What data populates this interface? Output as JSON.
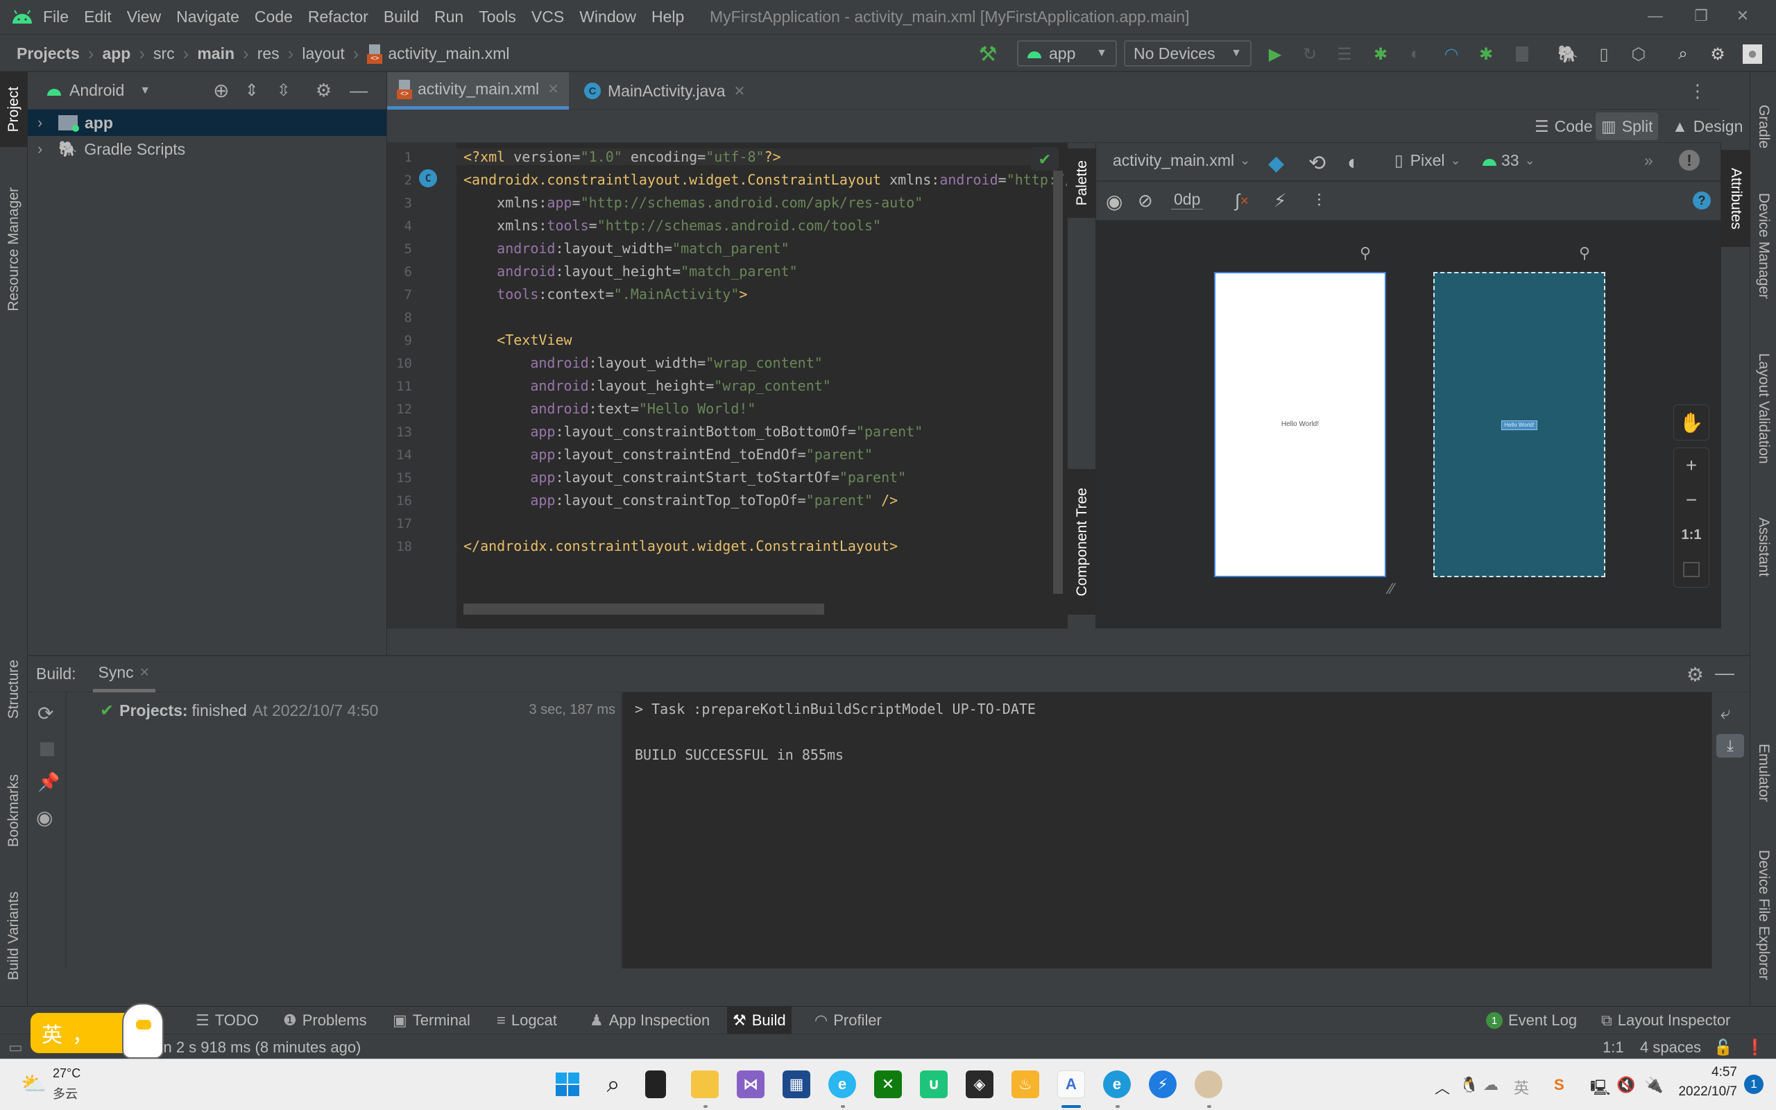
{
  "app": {
    "window_title": "MyFirstApplication - activity_main.xml [MyFirstApplication.app.main]",
    "menu": [
      "File",
      "Edit",
      "View",
      "Navigate",
      "Code",
      "Refactor",
      "Build",
      "Run",
      "Tools",
      "VCS",
      "Window",
      "Help"
    ],
    "window_controls": {
      "minimize": "—",
      "restore": "❐",
      "close": "✕"
    }
  },
  "breadcrumb": [
    "Projects",
    "app",
    "src",
    "main",
    "res",
    "layout",
    "activity_main.xml"
  ],
  "toolbar": {
    "run_config": "app",
    "device": "No Devices",
    "icons": [
      "build-hammer-icon",
      "run-icon",
      "apply-changes-icon",
      "apply-code-changes-icon",
      "debug-icon",
      "attach-debugger-icon",
      "profile-icon",
      "attach-profiler-icon",
      "stop-icon",
      "gradle-sync-icon",
      "device-manager-icon",
      "sdk-manager-icon",
      "search-icon",
      "settings-icon",
      "account-icon"
    ]
  },
  "left_strip": {
    "tabs": [
      "Project",
      "Resource Manager",
      "Structure",
      "Bookmarks",
      "Build Variants"
    ]
  },
  "project_panel": {
    "view_selector": "Android",
    "tree": [
      {
        "label": "app",
        "selected": true,
        "icon": "module-folder-icon"
      },
      {
        "label": "Gradle Scripts",
        "selected": false,
        "icon": "gradle-elephant-icon"
      }
    ]
  },
  "editor_tabs": [
    {
      "label": "activity_main.xml",
      "active": true,
      "icon": "xml-file-icon"
    },
    {
      "label": "MainActivity.java",
      "active": false,
      "icon": "class-icon"
    }
  ],
  "view_modes": [
    {
      "label": "Code",
      "active": false
    },
    {
      "label": "Split",
      "active": true
    },
    {
      "label": "Design",
      "active": false
    }
  ],
  "code": {
    "line_numbers": [
      "1",
      "2",
      "3",
      "4",
      "5",
      "6",
      "7",
      "8",
      "9",
      "10",
      "11",
      "12",
      "13",
      "14",
      "15",
      "16",
      "17",
      "18"
    ],
    "lines": [
      [
        {
          "t": "tag",
          "v": "<?xml "
        },
        {
          "t": "attr",
          "v": "version"
        },
        {
          "t": "eq",
          "v": "="
        },
        {
          "t": "val",
          "v": "\"1.0\""
        },
        {
          "t": "attr",
          "v": " encoding"
        },
        {
          "t": "eq",
          "v": "="
        },
        {
          "t": "val",
          "v": "\"utf-8\""
        },
        {
          "t": "tag",
          "v": "?>"
        }
      ],
      [
        {
          "t": "tag",
          "v": "<androidx.constraintlayout.widget.ConstraintLayout "
        },
        {
          "t": "attr",
          "v": "xmlns:"
        },
        {
          "t": "ns",
          "v": "android"
        },
        {
          "t": "eq",
          "v": "="
        },
        {
          "t": "val",
          "v": "\"http://"
        }
      ],
      [
        {
          "t": "attr",
          "v": "    xmlns:"
        },
        {
          "t": "ns",
          "v": "app"
        },
        {
          "t": "eq",
          "v": "="
        },
        {
          "t": "val",
          "v": "\"http://schemas.android.com/apk/res-auto\""
        }
      ],
      [
        {
          "t": "attr",
          "v": "    xmlns:"
        },
        {
          "t": "ns",
          "v": "tools"
        },
        {
          "t": "eq",
          "v": "="
        },
        {
          "t": "val",
          "v": "\"http://schemas.android.com/tools\""
        }
      ],
      [
        {
          "t": "ns",
          "v": "    android"
        },
        {
          "t": "attr",
          "v": ":layout_width"
        },
        {
          "t": "eq",
          "v": "="
        },
        {
          "t": "val",
          "v": "\"match_parent\""
        }
      ],
      [
        {
          "t": "ns",
          "v": "    android"
        },
        {
          "t": "attr",
          "v": ":layout_height"
        },
        {
          "t": "eq",
          "v": "="
        },
        {
          "t": "val",
          "v": "\"match_parent\""
        }
      ],
      [
        {
          "t": "ns",
          "v": "    tools"
        },
        {
          "t": "attr",
          "v": ":context"
        },
        {
          "t": "eq",
          "v": "="
        },
        {
          "t": "val",
          "v": "\".MainActivity\""
        },
        {
          "t": "tag",
          "v": ">"
        }
      ],
      [],
      [
        {
          "t": "tag",
          "v": "    <TextView"
        }
      ],
      [
        {
          "t": "ns",
          "v": "        android"
        },
        {
          "t": "attr",
          "v": ":layout_width"
        },
        {
          "t": "eq",
          "v": "="
        },
        {
          "t": "val",
          "v": "\"wrap_content\""
        }
      ],
      [
        {
          "t": "ns",
          "v": "        android"
        },
        {
          "t": "attr",
          "v": ":layout_height"
        },
        {
          "t": "eq",
          "v": "="
        },
        {
          "t": "val",
          "v": "\"wrap_content\""
        }
      ],
      [
        {
          "t": "ns",
          "v": "        android"
        },
        {
          "t": "attr",
          "v": ":text"
        },
        {
          "t": "eq",
          "v": "="
        },
        {
          "t": "val",
          "v": "\"Hello World!\""
        }
      ],
      [
        {
          "t": "ns",
          "v": "        app"
        },
        {
          "t": "attr",
          "v": ":layout_constraintBottom_toBottomOf"
        },
        {
          "t": "eq",
          "v": "="
        },
        {
          "t": "val",
          "v": "\"parent\""
        }
      ],
      [
        {
          "t": "ns",
          "v": "        app"
        },
        {
          "t": "attr",
          "v": ":layout_constraintEnd_toEndOf"
        },
        {
          "t": "eq",
          "v": "="
        },
        {
          "t": "val",
          "v": "\"parent\""
        }
      ],
      [
        {
          "t": "ns",
          "v": "        app"
        },
        {
          "t": "attr",
          "v": ":layout_constraintStart_toStartOf"
        },
        {
          "t": "eq",
          "v": "="
        },
        {
          "t": "val",
          "v": "\"parent\""
        }
      ],
      [
        {
          "t": "ns",
          "v": "        app"
        },
        {
          "t": "attr",
          "v": ":layout_constraintTop_toTopOf"
        },
        {
          "t": "eq",
          "v": "="
        },
        {
          "t": "val",
          "v": "\"parent\""
        },
        {
          "t": "tag",
          "v": " />"
        }
      ],
      [],
      [
        {
          "t": "tag",
          "v": "</androidx.constraintlayout.widget.ConstraintLayout>"
        }
      ]
    ]
  },
  "palette_strip": {
    "top": "Palette",
    "bottom": "Component Tree"
  },
  "design": {
    "file_selector": "activity_main.xml",
    "device": "Pixel",
    "api_level": "33",
    "margin": "0dp",
    "preview_text": "Hello World!",
    "zoom_controls": [
      "+",
      "−",
      "1:1"
    ]
  },
  "attributes_strip": "Attributes",
  "right_strip": {
    "tabs": [
      "Gradle",
      "Device Manager",
      "Layout Validation",
      "Assistant",
      "Emulator",
      "Device File Explorer"
    ]
  },
  "build_panel": {
    "label": "Build:",
    "tab": "Sync",
    "tree_item": {
      "bold": "Projects:",
      "status": "finished",
      "time": "At 2022/10/7 4:50",
      "duration": "3 sec, 187 ms"
    },
    "console": [
      "> Task :prepareKotlinBuildScriptModel UP-TO-DATE",
      "",
      "BUILD SUCCESSFUL in 855ms"
    ]
  },
  "tool_windows": {
    "left": [
      "TODO",
      "Problems",
      "Terminal",
      "Logcat",
      "App Inspection",
      "Build",
      "Profiler"
    ],
    "active": "Build",
    "event_log": {
      "label": "Event Log",
      "count": "1"
    },
    "layout_inspector": "Layout Inspector"
  },
  "status_bar": {
    "message": "ed in 2 s 918 ms (8 minutes ago)",
    "position": "1:1",
    "indent": "4 spaces"
  },
  "ime": {
    "label": "英",
    "punct": "，"
  },
  "taskbar": {
    "weather": {
      "temp": "27°C",
      "desc": "多云"
    },
    "apps": [
      "Start",
      "Search",
      "Task View",
      "File Explorer",
      "Visual Studio",
      "Microsoft Store",
      "Browser",
      "Xbox",
      "Shop",
      "Unity",
      "Shield",
      "Android Studio",
      "Edge",
      "Thunder",
      "Photo"
    ],
    "tray": {
      "ime": "英",
      "time": "4:57",
      "date": "2022/10/7",
      "notifications": "1"
    }
  },
  "colors": {
    "accent": "#4a88c7",
    "selection": "#0d293e",
    "android_green": "#3ddc84",
    "success_green": "#4cae4f",
    "blueprint": "#225b6e",
    "ime_yellow": "#ffc200"
  }
}
